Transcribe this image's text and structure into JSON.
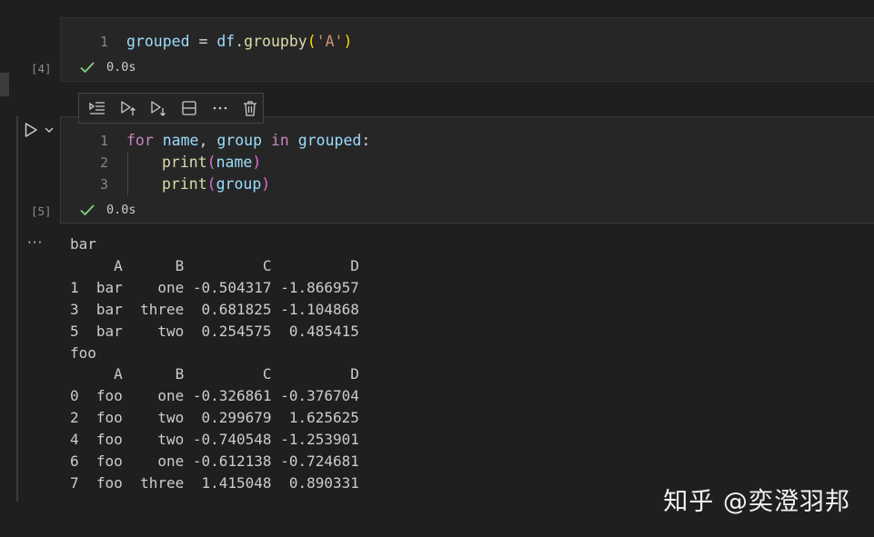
{
  "cells": [
    {
      "exec_count": "[4]",
      "line_numbers": [
        "1"
      ],
      "code": {
        "l1": {
          "a": "grouped",
          "b": " = ",
          "c": "df",
          "d": ".",
          "e": "groupby",
          "f": "(",
          "g": "'A'",
          "h": ")"
        }
      },
      "status_time": "0.0s"
    },
    {
      "exec_count": "[5]",
      "line_numbers": [
        "1",
        "2",
        "3"
      ],
      "code": {
        "l1": {
          "a": "for",
          "b": " ",
          "c": "name",
          "d": ", ",
          "e": "group",
          "f": " ",
          "g": "in",
          "h": " ",
          "i": "grouped",
          "j": ":"
        },
        "l2": {
          "a": "print",
          "b": "(",
          "c": "name",
          "d": ")"
        },
        "l3": {
          "a": "print",
          "b": "(",
          "c": "group",
          "d": ")"
        }
      },
      "status_time": "0.0s"
    }
  ],
  "output": {
    "more_glyph": "···",
    "text": "bar\n     A      B         C         D\n1  bar    one -0.504317 -1.866957\n3  bar  three  0.681825 -1.104868\n5  bar    two  0.254575  0.485415\nfoo\n     A      B         C         D\n0  foo    one -0.326861 -0.376704\n2  foo    two  0.299679  1.625625\n4  foo    two -0.740548 -1.253901\n6  foo    one -0.612138 -0.724681\n7  foo  three  1.415048  0.890331"
  },
  "toolbar": {
    "icons": [
      "run-by-line-icon",
      "execute-above-icon",
      "execute-below-icon",
      "split-cell-icon",
      "more-icon",
      "delete-icon"
    ]
  },
  "watermark": "知乎 @奕澄羽邦",
  "colors": {
    "background": "#1f1f1f",
    "cell": "#262626",
    "check": "#89d185",
    "keyword": "#c586c0",
    "variable": "#9cdcfe",
    "function": "#dcdcaa",
    "string": "#ce9178"
  }
}
